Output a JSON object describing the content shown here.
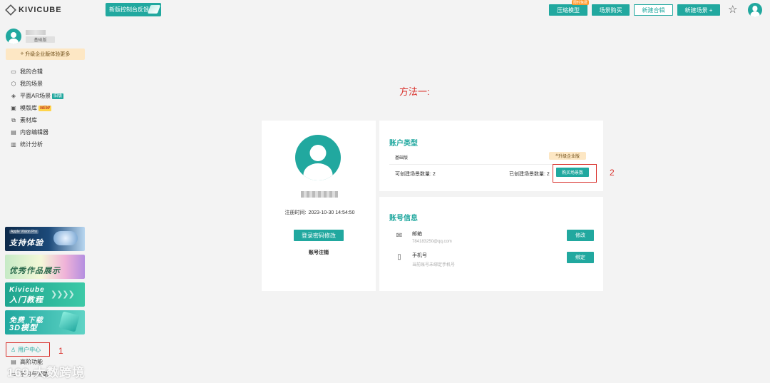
{
  "header": {
    "logo_text": "KIVICUBE",
    "feedback_label": "新版控制台反馈",
    "compress_label": "压缩模型",
    "compress_tag": "限时免费",
    "buy_scene_label": "场景购买",
    "new_album_label": "新建合辑",
    "new_scene_label": "新建场景 +",
    "star_icon": "☆"
  },
  "sidebar": {
    "plan_badge": "基础版",
    "upgrade_text": "升级企业版体验更多",
    "items": [
      {
        "icon": "folder-icon",
        "glyph": "▭",
        "label": "我的合辑"
      },
      {
        "icon": "cube-icon",
        "glyph": "⬡",
        "label": "我的场景"
      },
      {
        "icon": "ar-icon",
        "glyph": "◈",
        "label": "平面AR场景",
        "tag": "旧版"
      },
      {
        "icon": "template-icon",
        "glyph": "▣",
        "label": "模版库",
        "tag": "NEW"
      },
      {
        "icon": "material-icon",
        "glyph": "⧉",
        "label": "素材库"
      },
      {
        "icon": "editor-icon",
        "glyph": "▤",
        "label": "内容编辑器"
      },
      {
        "icon": "stats-icon",
        "glyph": "▥",
        "label": "统计分析"
      }
    ],
    "promos": {
      "p1_small": "Apple Vision Pro",
      "p1_big": "支持体验",
      "p2_big": "优秀作品展示",
      "p3_line1": "Kivicube",
      "p3_line2": "入门教程",
      "p4_line1": "免费 下载",
      "p4_line2": "3D模型"
    },
    "user_center_label": "用户中心",
    "annotation_1": "1",
    "bottom_item_1": "高阶功能",
    "bottom_item_2": "学习与帮助",
    "watermark": "169 大数跨境"
  },
  "main": {
    "method_title": "方法一:",
    "profile": {
      "reg_label": "注册时间:",
      "reg_time": "2023-10-30 14:54:50",
      "change_pw_label": "登录密码修改",
      "logout_label": "账号注销"
    },
    "account_type": {
      "title": "账户类型",
      "plan": "基础版",
      "upgrade_label": "升级企业版",
      "creatable_label": "可创建场景数量:",
      "creatable_value": "2",
      "created_label": "已创建场景数量:",
      "created_value": "2",
      "buy_label": "购买场景数",
      "annotation_2": "2"
    },
    "account_info": {
      "title": "账号信息",
      "email_label": "邮箱",
      "email_value": "784183250@qq.com",
      "email_button": "修改",
      "phone_label": "手机号",
      "phone_value": "当前账号未绑定手机号",
      "phone_button": "绑定"
    }
  }
}
